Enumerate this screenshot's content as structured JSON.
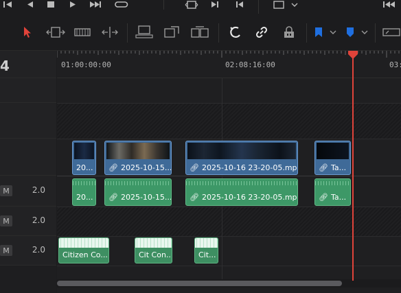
{
  "ruler": {
    "timecodes": [
      "01:00:00:00",
      "02:08:16:00",
      "03:"
    ]
  },
  "header": {
    "timecode_fragment": "4",
    "tracks": [
      {
        "mute": "M",
        "level": "2.0"
      },
      {
        "mute": "M",
        "level": "2.0"
      },
      {
        "mute": "M",
        "level": "2.0"
      }
    ]
  },
  "video_clips": [
    {
      "label": "20..."
    },
    {
      "label": "2025-10-15..."
    },
    {
      "label": "2025-10-16 23-20-05.mp4"
    },
    {
      "label": "Ta..."
    }
  ],
  "audio_clips": [
    {
      "label": "20..."
    },
    {
      "label": "2025-10-15..."
    },
    {
      "label": "2025-10-16 23-20-05.mp4"
    },
    {
      "label": "Ta..."
    }
  ],
  "music_clips": [
    {
      "label": "Citizen Co..."
    },
    {
      "label": "Cit Con..."
    },
    {
      "label": "Cit..."
    }
  ],
  "colors": {
    "video_clip": "#3f6a98",
    "audio_clip": "#3d9867",
    "playhead": "#e0433a",
    "flag_marker": "#1f6fe0"
  },
  "toolbar_icons": [
    "selection-arrow-icon",
    "trim-icon",
    "dynamic-trim-icon",
    "blade-icon",
    "overwrite-clip-icon",
    "replace-clip-icon",
    "ripple-overwrite-icon",
    "snapping-icon",
    "linked-selection-icon",
    "position-lock-icon",
    "flag-icon",
    "marker-icon",
    "zoom-icon"
  ]
}
